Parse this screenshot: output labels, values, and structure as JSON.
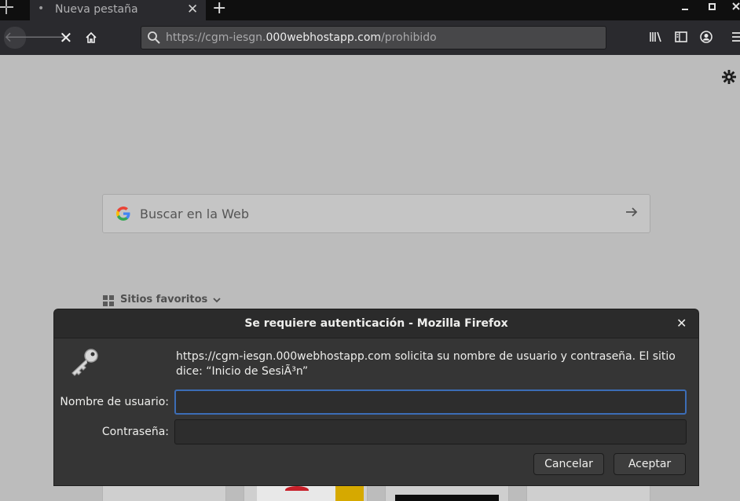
{
  "tab": {
    "title": "Nueva pestaña"
  },
  "urlbar": {
    "url_prefix": "https://cgm-iesgn.",
    "url_host": "000webhostapp.com",
    "url_path": "/prohibido"
  },
  "newtab": {
    "search_placeholder": "Buscar en la Web",
    "google_letter": "G",
    "topsites_label": "Sitios favoritos"
  },
  "dialog": {
    "title": "Se requiere autenticación - Mozilla Firefox",
    "message": "https://cgm-iesgn.000webhostapp.com solicita su nombre de usuario y contraseña. El sitio dice: “Inicio de SesiÃ³n”",
    "username_label": "Nombre de usuario:",
    "username_value": "",
    "password_label": "Contraseña:",
    "password_value": "",
    "cancel_label": "Cancelar",
    "accept_label": "Aceptar"
  },
  "colors": {
    "focus_ring": "#3c6db6",
    "tab_bar": "#0f0f0f",
    "toolbar": "#2a2a2e",
    "dialog_bg": "#353535"
  },
  "icons": [
    "move-cursor-icon",
    "tab-dot-icon",
    "close-tab-icon",
    "new-tab-icon",
    "minimize-icon",
    "maximize-icon",
    "close-window-icon",
    "back-icon",
    "forward-icon",
    "stop-icon",
    "home-icon",
    "search-icon",
    "library-icon",
    "sidebar-icon",
    "account-icon",
    "menu-icon",
    "gear-icon",
    "google-icon",
    "arrow-right-icon",
    "grid-icon",
    "chevron-down-icon",
    "key-icon"
  ]
}
